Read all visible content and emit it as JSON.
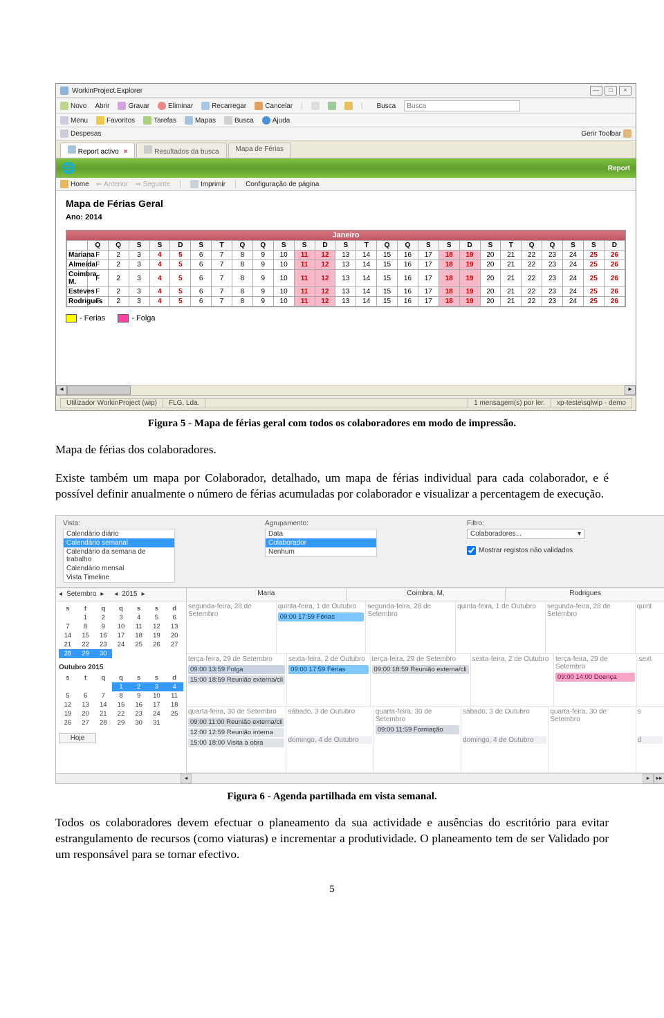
{
  "brand": {
    "name_first": "Workin",
    "name_second": "Project"
  },
  "app": {
    "window_title": "WorkinProject.Explorer",
    "toolbar1": {
      "novo": "Novo",
      "abrir": "Abrir",
      "gravar": "Gravar",
      "eliminar": "Eliminar",
      "recarregar": "Recarregar",
      "cancelar": "Cancelar",
      "busca_label": "Busca"
    },
    "toolbar2": {
      "menu": "Menu",
      "favoritos": "Favoritos",
      "tarefas": "Tarefas",
      "mapas": "Mapas",
      "busca": "Busca",
      "ajuda": "Ajuda"
    },
    "bar3": {
      "despesas": "Despesas",
      "gerir": "Gerir Toolbar"
    },
    "tabs": {
      "t1": "Report activo",
      "t2": "Resultados da busca",
      "t3": "Mapa de Férias"
    },
    "greenband": {
      "left": "Mapa de Férias Geral",
      "right": "Report"
    },
    "subbar": {
      "home": "Home",
      "anterior": "Anterior",
      "seguinte": "Seguinte",
      "imprimir": "Imprimir",
      "config": "Configuração de página"
    },
    "report": {
      "title": "Mapa de Férias Geral",
      "ano": "Ano: 2014",
      "month": "Janeiro",
      "weekdays": [
        "Q",
        "Q",
        "S",
        "S",
        "D",
        "S",
        "T",
        "Q",
        "Q",
        "S",
        "S",
        "D",
        "S",
        "T",
        "Q",
        "Q",
        "S",
        "S",
        "D",
        "S",
        "T",
        "Q",
        "Q",
        "S",
        "S",
        "D"
      ],
      "days": [
        "F",
        "2",
        "3",
        "4",
        "5",
        "6",
        "7",
        "8",
        "9",
        "10",
        "11",
        "12",
        "13",
        "14",
        "15",
        "16",
        "17",
        "18",
        "19",
        "20",
        "21",
        "22",
        "23",
        "24",
        "25",
        "26"
      ],
      "people": [
        "Mariana",
        "Almeida",
        "Coimbra, M.",
        "Esteves",
        "Rodrigues"
      ],
      "legend_ferias": "- Ferias",
      "legend_folga": "- Folga"
    },
    "status": {
      "user": "Utilizador WorkinProject (wip)",
      "firm": "FLG, Lda.",
      "msg": "1 mensagem(s) por ler.",
      "db": "xp-teste\\sqlwip - demo"
    }
  },
  "caption1": "Figura 5 - Mapa de férias geral com todos os colaboradores em modo de impressão.",
  "para1": "Mapa de férias dos colaboradores.",
  "para2": "Existe também um mapa por Colaborador, detalhado, um mapa de férias individual para cada colaborador, e é possível definir anualmente o número de férias acumuladas por colaborador e visualizar a percentagem de execução.",
  "caption2": "Figura 6 - Agenda partilhada em vista semanal.",
  "para3": "Todos os colaboradores devem efectuar o planeamento da sua actividade e ausências do escritório para evitar estrangulamento de recursos (como viaturas) e incrementar a produtividade. O planeamento tem de ser Validado por um responsável para se tornar efectivo.",
  "shot2": {
    "labels": {
      "vista": "Vista:",
      "agrup": "Agrupamento:",
      "filtro": "Filtro:"
    },
    "vista_list": [
      "Calendário diário",
      "Calendário semanal",
      "Calendário da semana de trabalho",
      "Calendário mensal",
      "Vista Timeline"
    ],
    "agrup_list": [
      "Data",
      "Colaborador",
      "Nenhum"
    ],
    "colab": "Colaboradores...",
    "mostrar": "Mostrar registos não validados",
    "nav": {
      "month": "Setembro",
      "year": "2015"
    },
    "nav2": {
      "month": "Outubro",
      "year": "2015"
    },
    "hoje": "Hoje",
    "people": [
      "Maria",
      "Coimbra, M.",
      "Rodrigues"
    ],
    "week1": {
      "dayA": "segunda-feira, 28 de Setembro",
      "dayB": "quinta-feira, 1 de Outubro"
    },
    "week2": {
      "dayA": "terça-feira, 29 de Setembro",
      "dayB": "sexta-feira, 2 de Outubro"
    },
    "week3": {
      "dayA": "quarta-feira, 30 de Setembro",
      "dayB": "sábado, 3 de Outubro",
      "dayC": "domingo, 4 de Outubro"
    },
    "ev": {
      "ferias": "09:00 17:59 Férias",
      "folga": "09:00 13:59 Folga",
      "reunext": "15:00 18:59 Reunião externa/cli",
      "reunext2": "09:00 11:00 Reunião externa/cli",
      "reunint": "12:00 12:59 Reunião interna",
      "visita": "15:00 18:00 Visita à obra",
      "reunext3": "09:00 18:59 Reunião externa/cli",
      "form": "09:00 11:59 Formação",
      "doenca": "09:00 14:00 Doença"
    },
    "wd": [
      "s",
      "t",
      "q",
      "q",
      "s",
      "s",
      "d"
    ],
    "sep": {
      "rows": [
        [
          "",
          "1",
          "2",
          "3",
          "4",
          "5",
          "6"
        ],
        [
          "7",
          "8",
          "9",
          "10",
          "11",
          "12",
          "13"
        ],
        [
          "14",
          "15",
          "16",
          "17",
          "18",
          "19",
          "20"
        ],
        [
          "21",
          "22",
          "23",
          "24",
          "25",
          "26",
          "27"
        ],
        [
          "28",
          "29",
          "30",
          "",
          "",
          "",
          ""
        ]
      ]
    },
    "oct": {
      "rows": [
        [
          "",
          "",
          "",
          "1",
          "2",
          "3",
          "4"
        ],
        [
          "5",
          "6",
          "7",
          "8",
          "9",
          "10",
          "11"
        ],
        [
          "12",
          "13",
          "14",
          "15",
          "16",
          "17",
          "18"
        ],
        [
          "19",
          "20",
          "21",
          "22",
          "23",
          "24",
          "25"
        ],
        [
          "26",
          "27",
          "28",
          "29",
          "30",
          "31",
          ""
        ]
      ]
    }
  },
  "pagenum": "5"
}
